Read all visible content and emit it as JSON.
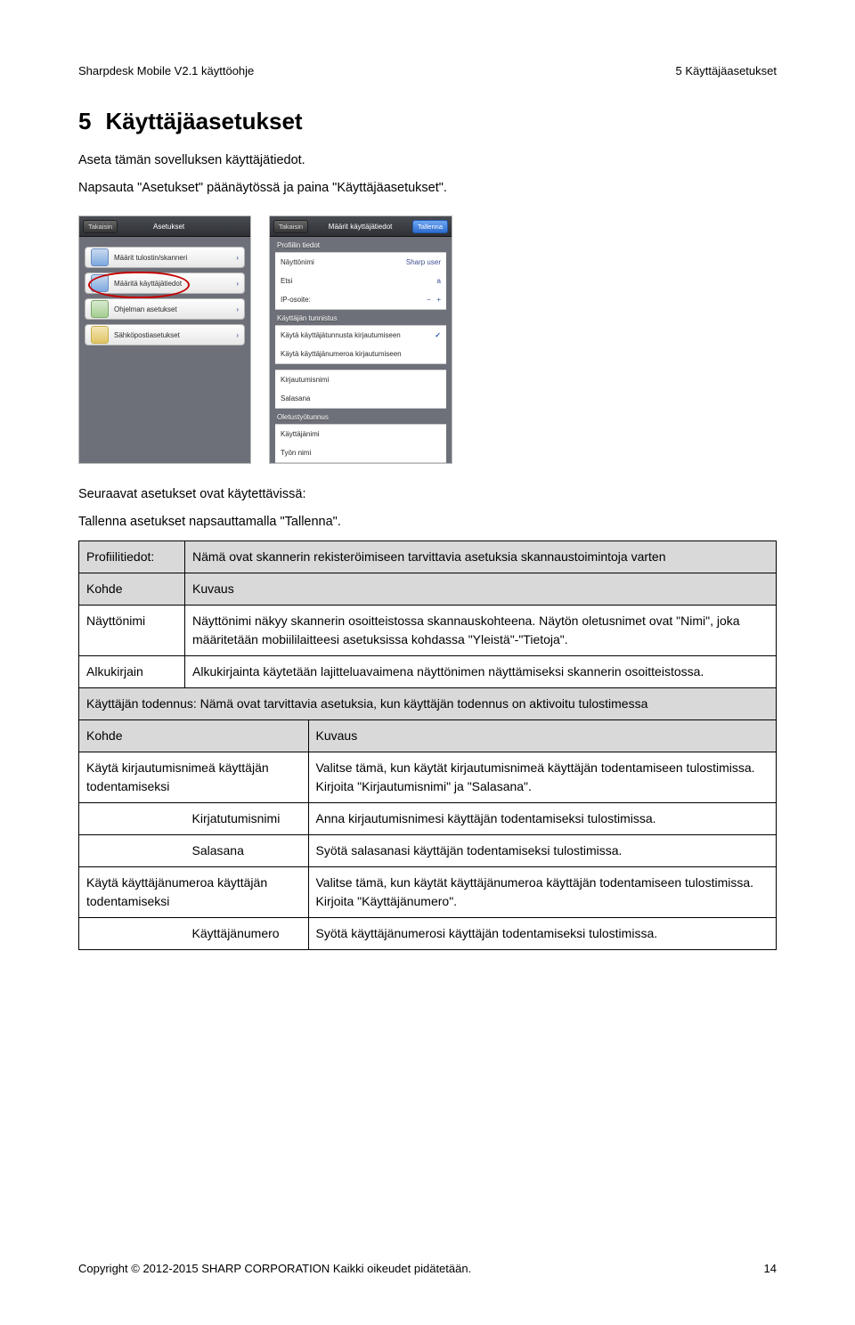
{
  "header": {
    "left": "Sharpdesk Mobile V2.1 käyttöohje",
    "right": "5 Käyttäjäasetukset"
  },
  "title_num": "5",
  "title": "Käyttäjäasetukset",
  "para1": "Aseta tämän sovelluksen käyttäjätiedot.",
  "para2": "Napsauta \"Asetukset\" päänäytössä ja paina \"Käyttäjäasetukset\".",
  "para3": "Seuraavat asetukset ovat käytettävissä:",
  "para4": "Tallenna asetukset napsauttamalla \"Tallenna\".",
  "shot1": {
    "back": "Takaisin",
    "title": "Asetukset",
    "rows": [
      "Määrit tulostin/skanneri",
      "Määritä käyttäjätiedot",
      "Ohjelman asetukset",
      "Sähköpostiasetukset"
    ]
  },
  "shot2": {
    "back": "Takaisin",
    "title": "Määrit käyttäjätiedot",
    "save": "Tallenna",
    "s1": "Profiilin tiedot",
    "r1": "Näyttönimi",
    "r1v": "Sharp user",
    "r2": "Etsi",
    "r2v": "a",
    "r3": "IP-osoite:",
    "s2": "Käyttäjän tunnistus",
    "r4": "Käytä käyttäjätunnusta kirjautumiseen",
    "r5": "Käytä käyttäjänumeroa kirjautumiseen",
    "r6": "Kirjautumisnimi",
    "r7": "Salasana",
    "s3": "Oletustyötunnus",
    "r8": "Käyttäjänimi",
    "r9": "Työn nimi"
  },
  "tbl": {
    "sec1": {
      "label": "Profiilitiedot:",
      "desc": "Nämä ovat skannerin rekisteröimiseen tarvittavia asetuksia skannaustoimintoja varten"
    },
    "kohde": "Kohde",
    "kuvaus": "Kuvaus",
    "r1a": "Näyttönimi",
    "r1b": "Näyttönimi näkyy skannerin osoitteistossa skannauskohteena. Näytön oletusnimet ovat \"Nimi\", joka määritetään mobiililaitteesi asetuksissa kohdassa \"Yleistä\"-\"Tietoja\".",
    "r2a": "Alkukirjain",
    "r2b": "Alkukirjainta käytetään lajitteluavaimena näyttönimen näyttämiseksi skannerin osoitteistossa.",
    "sec2": "Käyttäjän todennus: Nämä ovat tarvittavia asetuksia, kun käyttäjän todennus on aktivoitu tulostimessa",
    "r3a": "Käytä kirjautumisnimeä käyttäjän todentamiseksi",
    "r3b": "Valitse tämä, kun käytät kirjautumisnimeä käyttäjän todentamiseen tulostimissa. Kirjoita \"Kirjautumisnimi\" ja \"Salasana\".",
    "r4a": "Kirjatutumisnimi",
    "r4b": "Anna kirjautumisnimesi käyttäjän todentamiseksi tulostimissa.",
    "r5a": "Salasana",
    "r5b": "Syötä salasanasi käyttäjän todentamiseksi tulostimissa.",
    "r6a": "Käytä käyttäjänumeroa käyttäjän todentamiseksi",
    "r6b": "Valitse tämä, kun käytät käyttäjänumeroa käyttäjän todentamiseen tulostimissa. Kirjoita \"Käyttäjänumero\".",
    "r7a": "Käyttäjänumero",
    "r7b": "Syötä käyttäjänumerosi käyttäjän todentamiseksi tulostimissa."
  },
  "footer": {
    "left": "Copyright © 2012-2015 SHARP CORPORATION Kaikki oikeudet pidätetään.",
    "right": "14"
  }
}
